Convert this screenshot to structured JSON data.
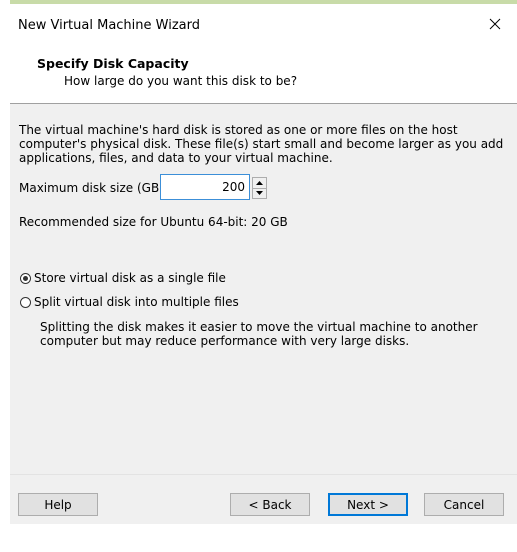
{
  "window": {
    "title": "New Virtual Machine Wizard",
    "close_icon": "close-icon"
  },
  "header": {
    "title": "Specify Disk Capacity",
    "subtitle": "How large do you want this disk to be?"
  },
  "content": {
    "description": "The virtual machine's hard disk is stored as one or more files on the host computer's physical disk. These file(s) start small and become larger as you add applications, files, and data to your virtual machine.",
    "max_size_label": "Maximum disk size (GB):",
    "max_size_value": "200",
    "recommended": "Recommended size for Ubuntu 64-bit: 20 GB",
    "options": [
      {
        "label": "Store virtual disk as a single file",
        "selected": true
      },
      {
        "label": "Split virtual disk into multiple files",
        "selected": false
      }
    ],
    "split_description": "Splitting the disk makes it easier to move the virtual machine to another computer but may reduce performance with very large disks."
  },
  "footer": {
    "help_label": "Help",
    "back_label": "< Back",
    "next_label": "Next >",
    "cancel_label": "Cancel"
  },
  "colors": {
    "accent": "#0078d7",
    "panel_bg": "#f0f0f0",
    "input_border": "#3c8fd8"
  }
}
